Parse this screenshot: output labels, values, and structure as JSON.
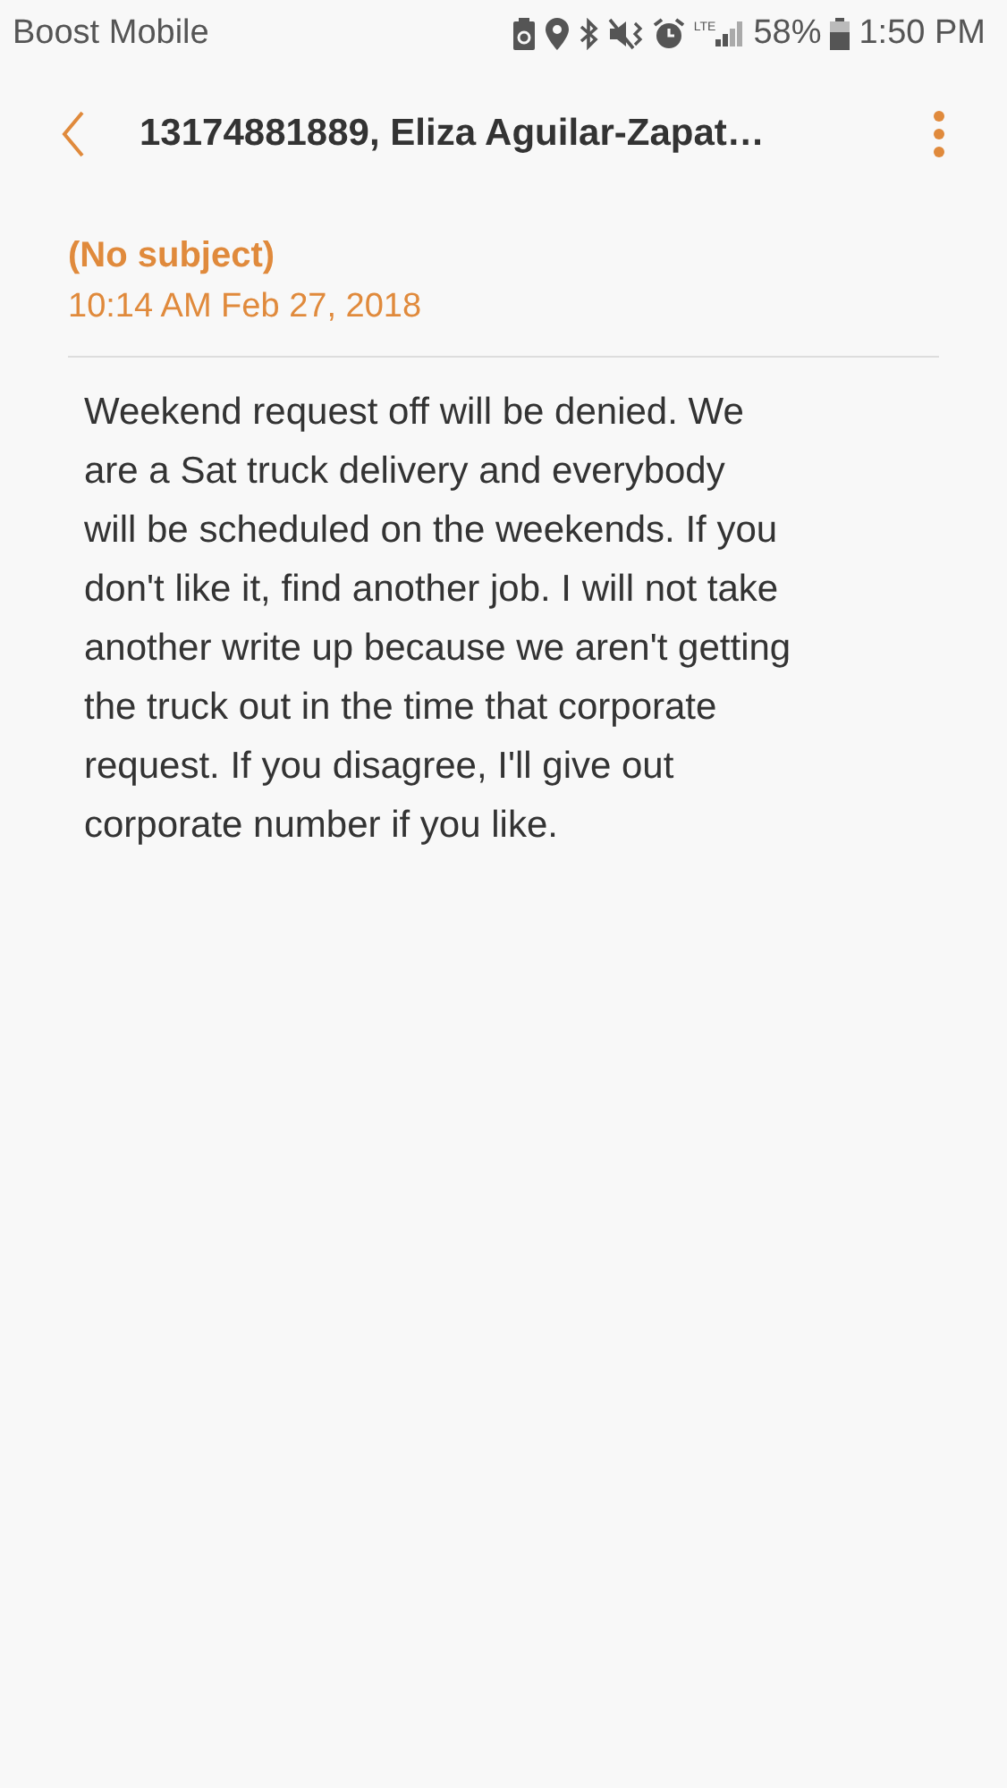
{
  "status_bar": {
    "carrier": "Boost Mobile",
    "network": "LTE",
    "battery": "58%",
    "time": "1:50 PM"
  },
  "header": {
    "title": "13174881889, Eliza Aguilar-Zapat…"
  },
  "message": {
    "subject": "(No subject)",
    "timestamp": "10:14 AM  Feb 27, 2018",
    "body_lines": [
      "Weekend request off will be denied. We",
      "are a Sat truck delivery and everybody",
      "will be scheduled on the weekends. If you",
      "don't like it, find another job. I will not take",
      "another write up because we aren't getting",
      "the truck out in the time that corporate",
      "request. If you disagree, I'll give out",
      "corporate number if you like."
    ]
  }
}
